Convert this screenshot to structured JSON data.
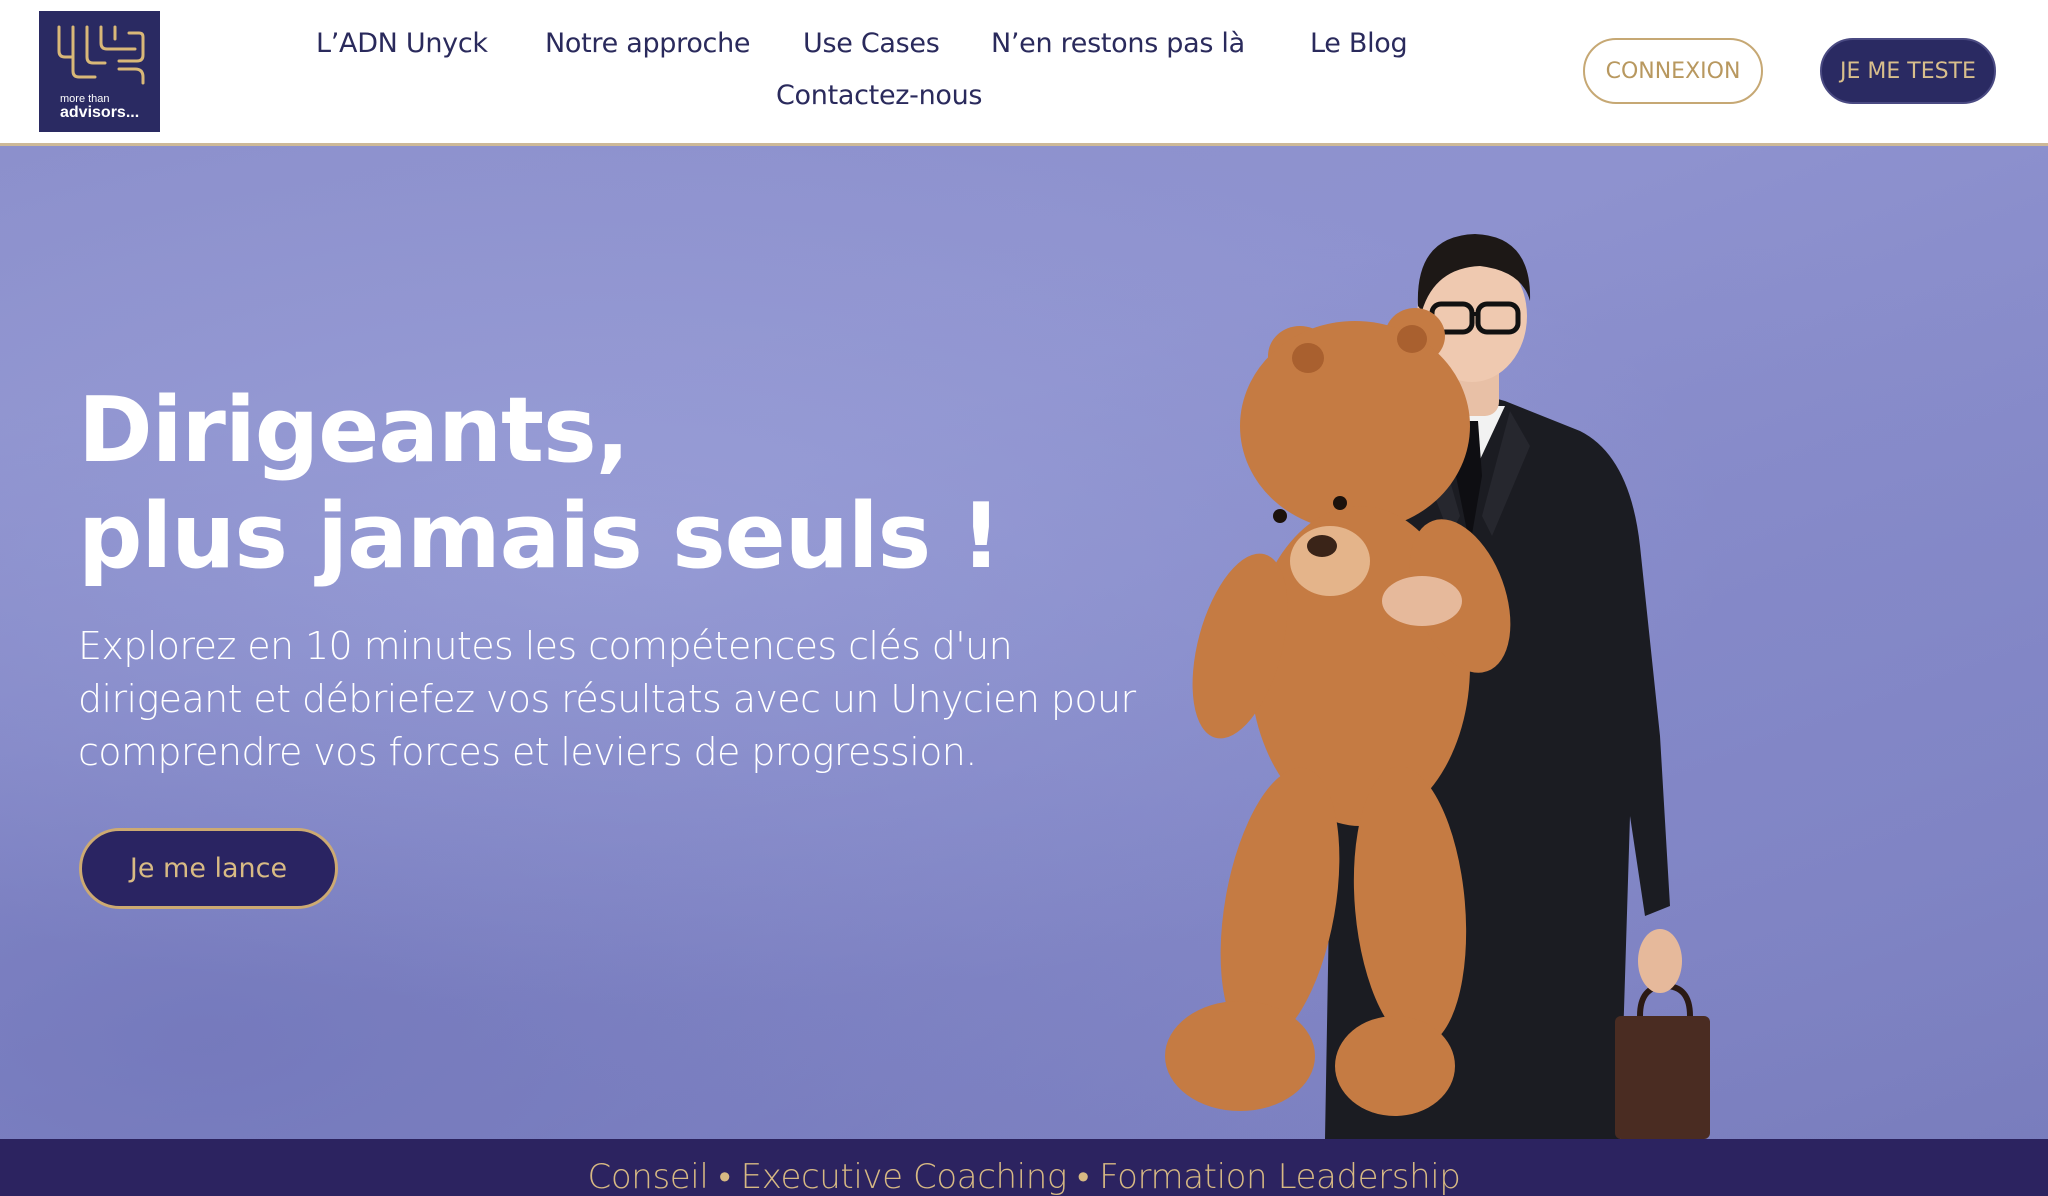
{
  "brand": {
    "logo_tagline": "more than",
    "logo_name": "advisors..."
  },
  "nav": {
    "items": [
      {
        "label": "L’ADN Unyck"
      },
      {
        "label": "Notre approche"
      },
      {
        "label": "Use Cases"
      },
      {
        "label": "N’en restons pas là"
      },
      {
        "label": "Le Blog"
      },
      {
        "label": "Contactez-nous"
      }
    ],
    "login_label": "CONNEXION",
    "test_label": "JE ME TESTE"
  },
  "hero": {
    "title_line1": "Dirigeants,",
    "title_line2": "plus jamais seuls !",
    "description": "Explorez en 10 minutes les compétences clés d'un dirigeant et débriefez vos résultats avec un Unycien pour comprendre vos forces et leviers de progression.",
    "cta_label": "Je me lance"
  },
  "band": {
    "services": "Conseil • Executive Coaching • Formation Leadership"
  },
  "colors": {
    "navy": "#2a2a62",
    "gold": "#c6a874",
    "hero_bg": "#8c90cc",
    "band_bg": "#2c2360"
  }
}
